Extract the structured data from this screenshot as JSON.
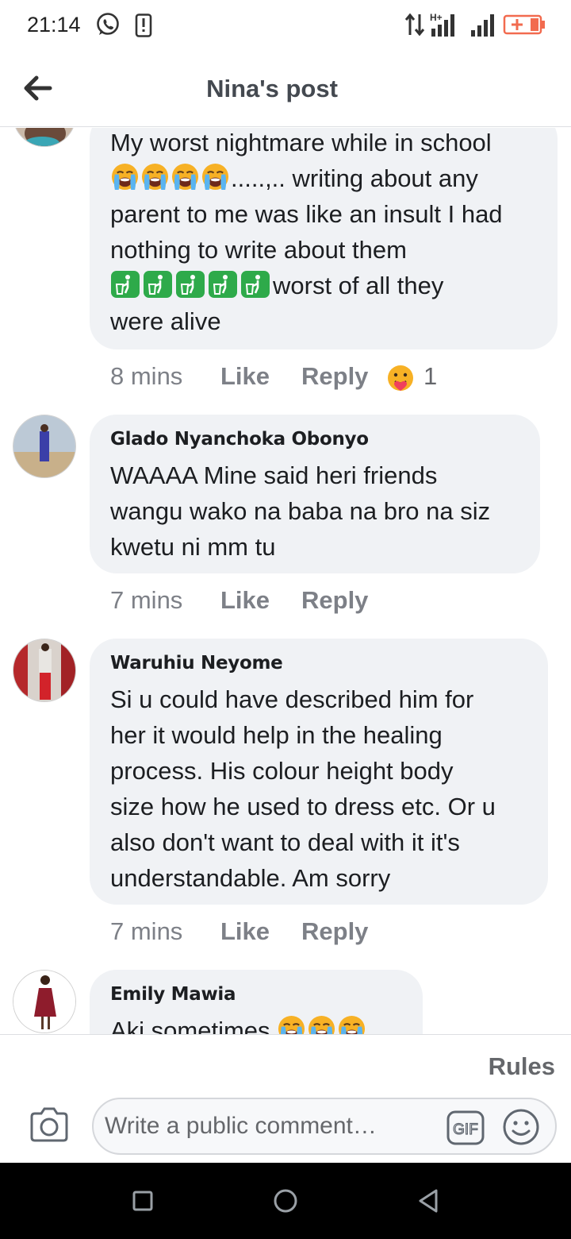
{
  "status_bar": {
    "time": "21:14",
    "network": "H+",
    "icons": [
      "whatsapp-icon",
      "phone-icon",
      "data-arrows-icon",
      "signal-icon",
      "battery-icon"
    ]
  },
  "header": {
    "title": "Nina's post",
    "back_icon": "arrow-left-icon"
  },
  "comments": [
    {
      "author": "",
      "text_line1": "My worst nightmare while in school",
      "emoji_run1": "loudly-crying-face-emoji",
      "text_line2_rest": ".....,.. writing about any",
      "text_line3": "parent to me was like an insult I had",
      "text_line4": "nothing to write about them",
      "emoji_run2": "put-litter-in-bin-emoji",
      "text_line5_rest": "worst of all they",
      "text_line6": "were alive",
      "time": "8 mins",
      "like_label": "Like",
      "reply_label": "Reply",
      "reaction_icon": "care-reaction-icon",
      "reaction_count": "1"
    },
    {
      "author": "Glado Nyanchoka Obonyo",
      "text": "WAAAA Mine said heri friends wangu wako na baba na bro na siz kwetu ni mm tu",
      "time": "7 mins",
      "like_label": "Like",
      "reply_label": "Reply"
    },
    {
      "author": "Waruhiu Neyome",
      "text": "Si u could have described him for her it would help in the healing process. His colour height body size how he used to dress etc. Or u also don't want to deal with it it's understandable. Am sorry",
      "time": "7 mins",
      "like_label": "Like",
      "reply_label": "Reply"
    },
    {
      "author": "Emily Mawia",
      "text": "Aki sometimes"
    }
  ],
  "rules": {
    "label": "Rules"
  },
  "composer": {
    "placeholder": "Write a public comment…",
    "gif_label": "GIF"
  },
  "nav": {
    "buttons": [
      "recent-apps-button",
      "home-button",
      "back-button"
    ]
  },
  "colors": {
    "bubble": "#f0f2f5",
    "muted_text": "#65676b",
    "battery": "#f26b4f",
    "emoji_bin": "#2eaa4a"
  }
}
